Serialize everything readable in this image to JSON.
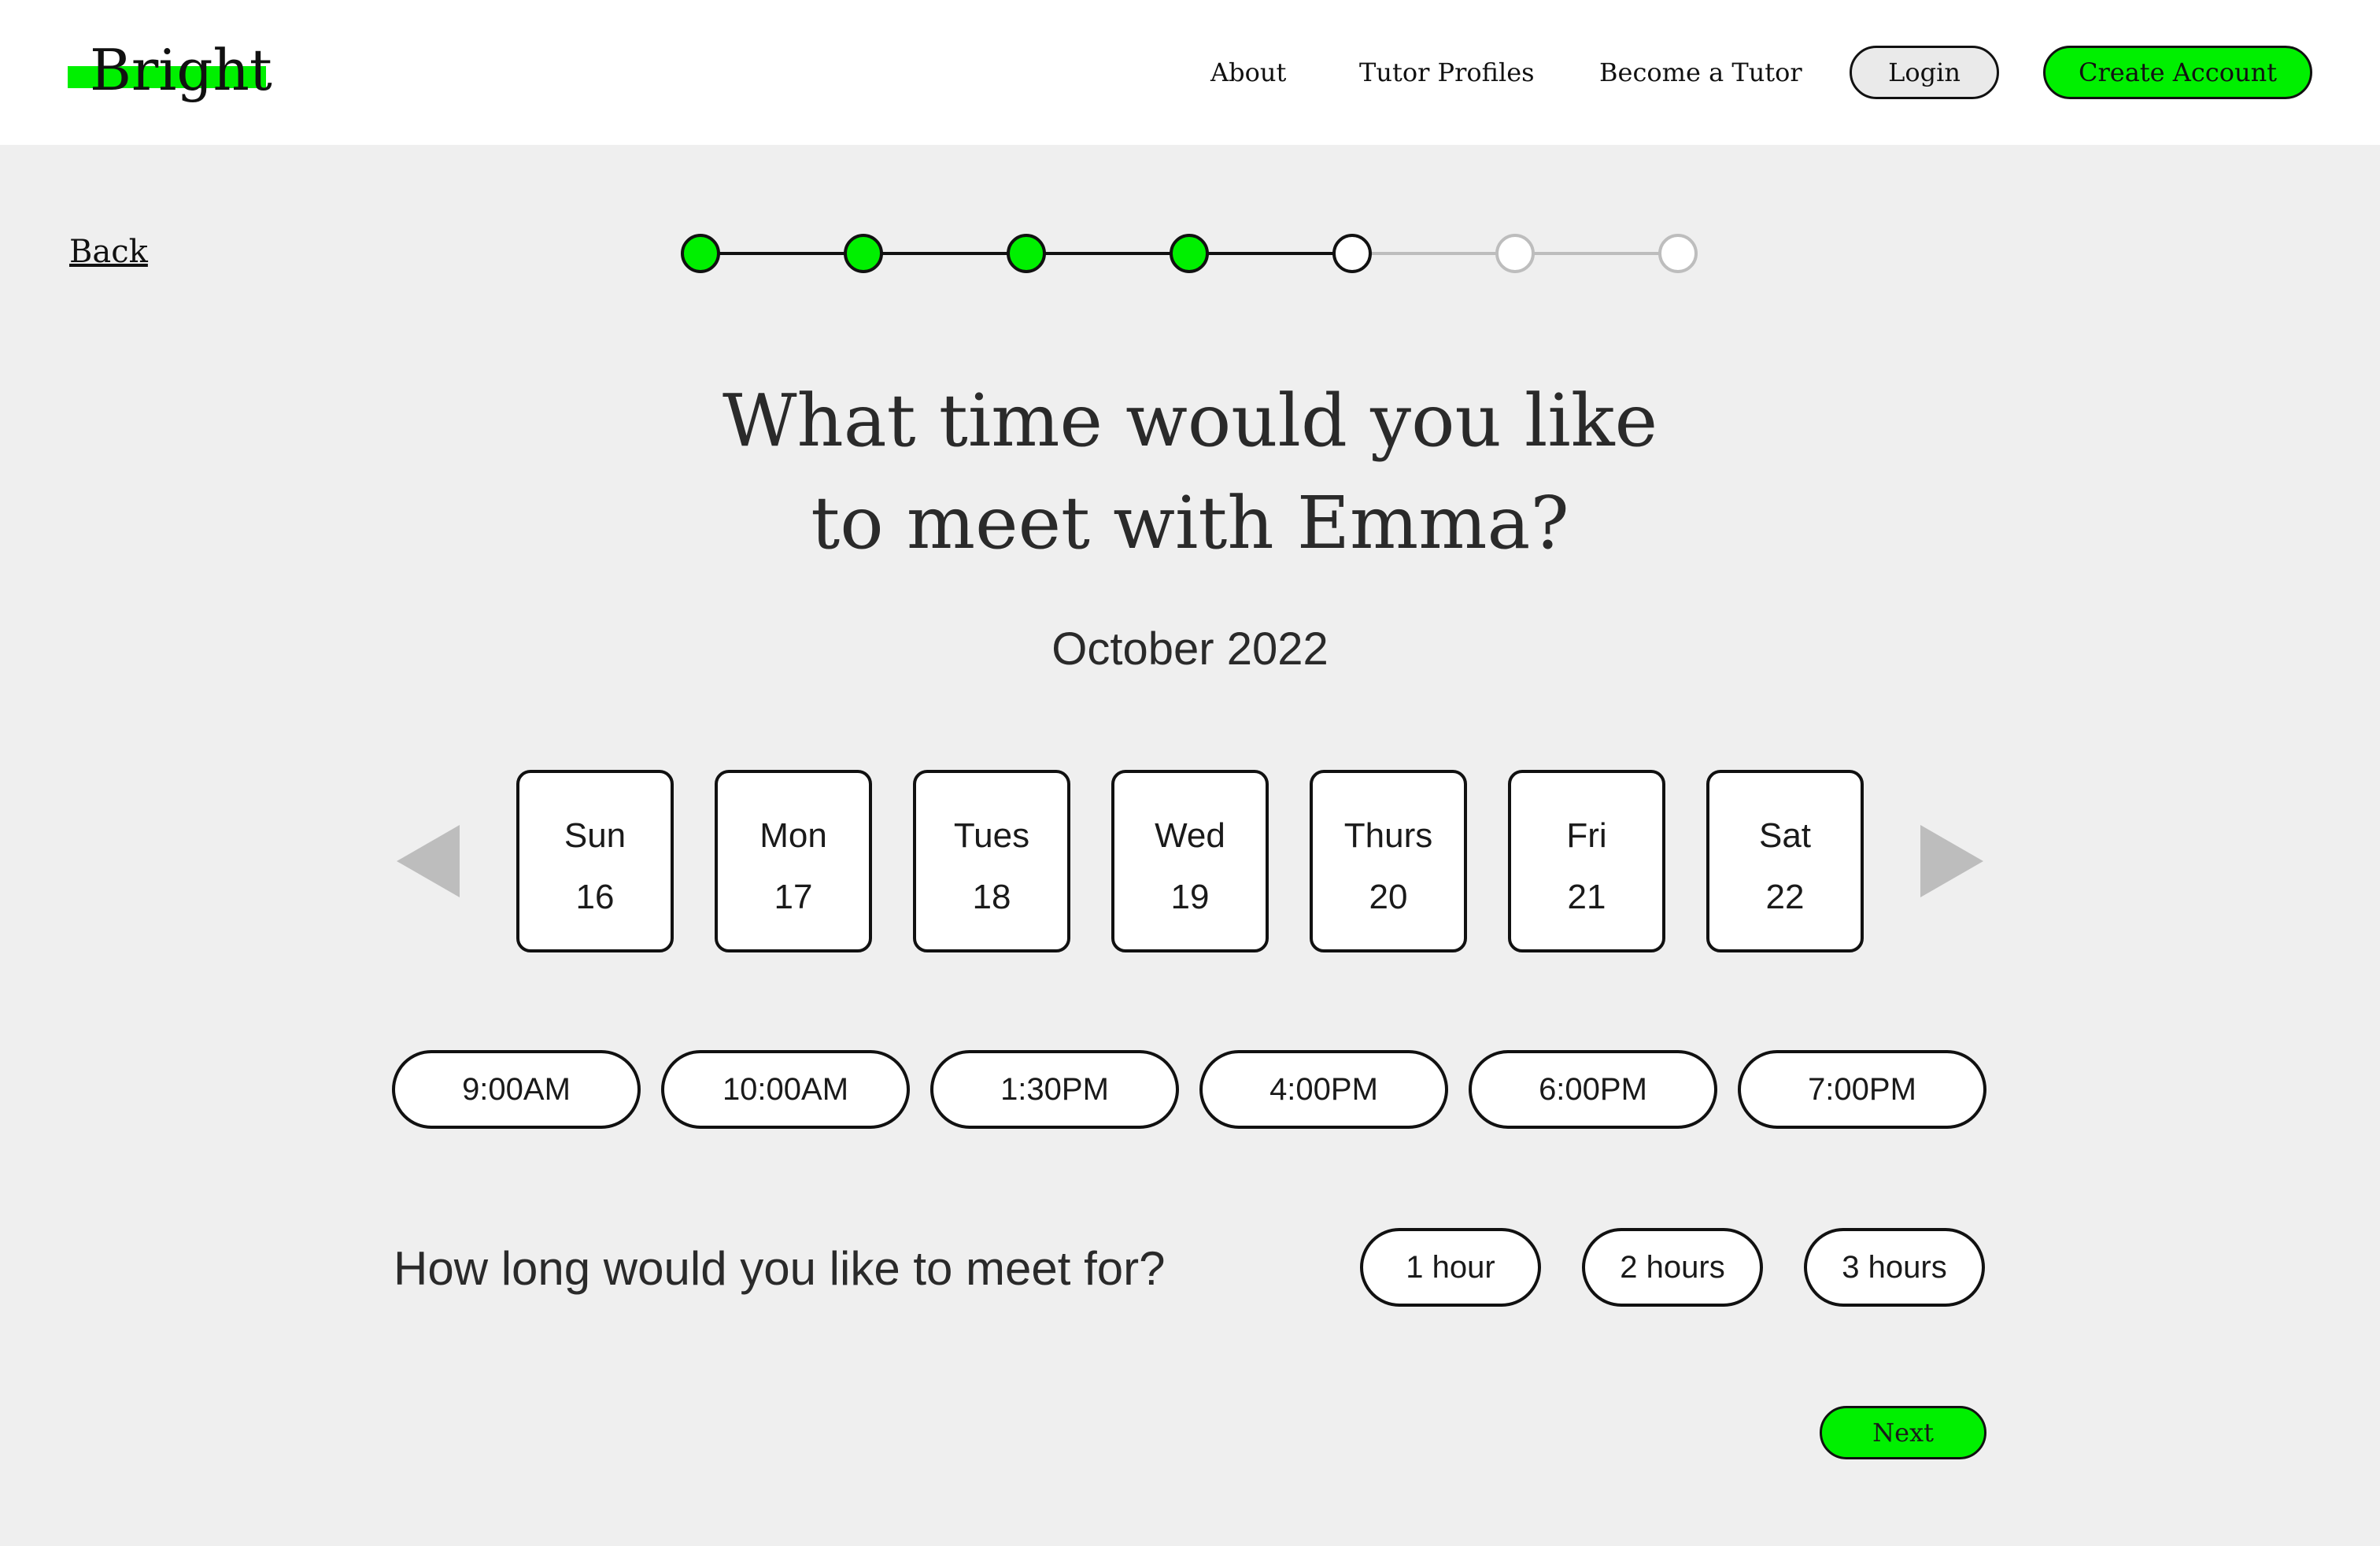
{
  "brand": {
    "name": "Bright",
    "accent": "#00f000"
  },
  "nav": {
    "links": [
      "About",
      "Tutor Profiles",
      "Become a Tutor"
    ],
    "login": "Login",
    "create_account": "Create Account"
  },
  "back_label": "Back",
  "progress": {
    "total_steps": 7,
    "completed_steps": 4,
    "current_step": 5
  },
  "question": {
    "line1": "What time would you like",
    "line2": "to meet with Emma?"
  },
  "month": "October 2022",
  "days": [
    {
      "name": "Sun",
      "date": "16"
    },
    {
      "name": "Mon",
      "date": "17"
    },
    {
      "name": "Tues",
      "date": "18"
    },
    {
      "name": "Wed",
      "date": "19"
    },
    {
      "name": "Thurs",
      "date": "20"
    },
    {
      "name": "Fri",
      "date": "21"
    },
    {
      "name": "Sat",
      "date": "22"
    }
  ],
  "times": [
    "9:00AM",
    "10:00AM",
    "1:30PM",
    "4:00PM",
    "6:00PM",
    "7:00PM"
  ],
  "duration": {
    "question": "How long would you like to meet for?",
    "options": [
      "1 hour",
      "2 hours",
      "3 hours"
    ]
  },
  "next_label": "Next",
  "icons": {
    "prev": "triangle-left-icon",
    "next": "triangle-right-icon"
  }
}
